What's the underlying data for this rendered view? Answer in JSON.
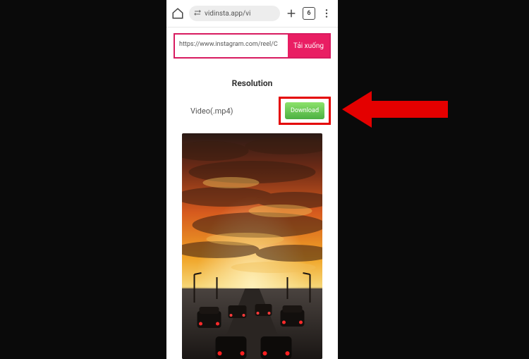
{
  "chrome": {
    "url_display": "vidinsta.app/vi",
    "tab_count": "6"
  },
  "search": {
    "value": "https://www.instagram.com/reel/C",
    "submit_label": "Tải xuống"
  },
  "results": {
    "header": "Resolution",
    "item_label": "Video(.mp4)",
    "download_label": "Download"
  }
}
